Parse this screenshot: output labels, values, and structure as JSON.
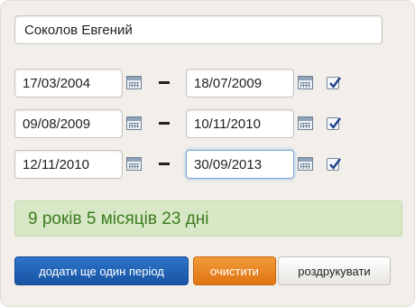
{
  "name_field": {
    "value": "Соколов Евгений"
  },
  "periods": [
    {
      "from": "17/03/2004",
      "to": "18/07/2009",
      "checked": true
    },
    {
      "from": "09/08/2009",
      "to": "10/11/2010",
      "checked": true
    },
    {
      "from": "12/11/2010",
      "to": "30/09/2013",
      "checked": true
    }
  ],
  "separator": "–",
  "result": {
    "text": "9 років 5 місяців 23 дні",
    "color": "#3b7d1e",
    "background": "#d8e7c6"
  },
  "buttons": {
    "add_period": "додати ще один період",
    "clear": "очистити",
    "print": "роздрукувати"
  },
  "icons": {
    "calendar": "calendar-icon",
    "checkbox": "checkbox-icon"
  },
  "colors": {
    "add_button": "#1f5fb3",
    "clear_button": "#e98424"
  }
}
